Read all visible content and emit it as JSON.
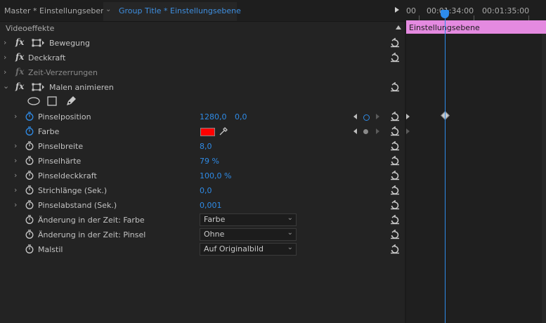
{
  "header": {
    "master_tab": "Master * Einstellungsebene",
    "group_tab": "Group Title * Einstellungsebene"
  },
  "timeline": {
    "timecode_start": "00",
    "timecode_mid": "00:01:34:00",
    "timecode_end": "00:01:35:00",
    "clip_label": "Einstellungsebene",
    "clip_color": "#e48ae0",
    "playhead_color": "#2d8ceb"
  },
  "panel": {
    "title": "Videoeffekte"
  },
  "effects": {
    "bewegung": "Bewegung",
    "deckkraft": "Deckkraft",
    "zeitverzerrungen": "Zeit-Verzerrungen",
    "malen": "Malen animieren"
  },
  "properties": {
    "pinselposition": {
      "label": "Pinselposition",
      "x": "1280,0",
      "y": "0,0"
    },
    "farbe": {
      "label": "Farbe",
      "swatch": "#ff0000"
    },
    "pinselbreite": {
      "label": "Pinselbreite",
      "value": "8,0"
    },
    "pinselhaerte": {
      "label": "Pinselhärte",
      "value": "79 %"
    },
    "pinseldeckkraft": {
      "label": "Pinseldeckkraft",
      "value": "100,0 %"
    },
    "strichlaenge": {
      "label": "Strichlänge (Sek.)",
      "value": "0,0"
    },
    "pinselabstand": {
      "label": "Pinselabstand (Sek.)",
      "value": "0,001"
    },
    "aenderung_farbe": {
      "label": "Änderung in der Zeit: Farbe",
      "value": "Farbe"
    },
    "aenderung_pinsel": {
      "label": "Änderung in der Zeit: Pinsel",
      "value": "Ohne"
    },
    "malstil": {
      "label": "Malstil",
      "value": "Auf Originalbild"
    }
  },
  "colors": {
    "accent_blue": "#2f8be6",
    "background": "#232323"
  }
}
